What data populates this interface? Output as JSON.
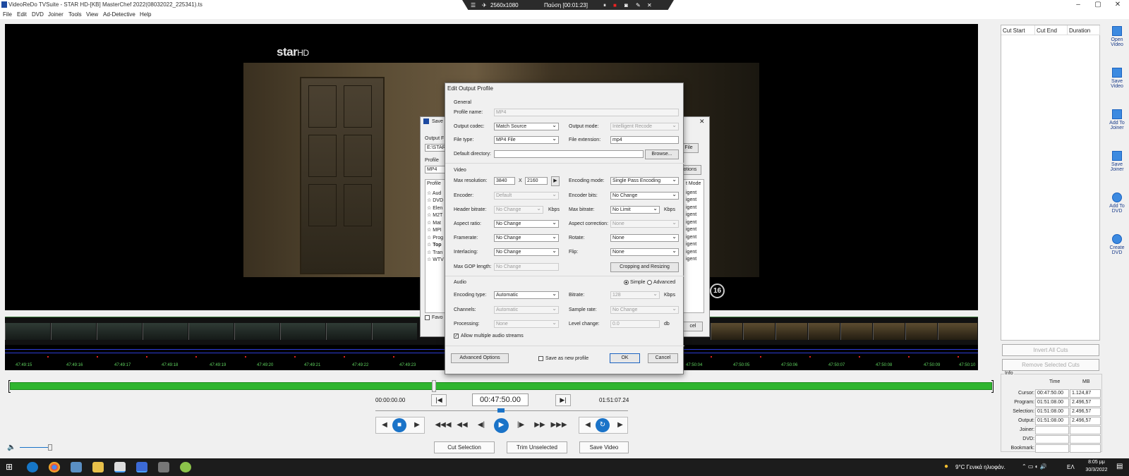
{
  "window": {
    "title": "VideoReDo TVSuite - STAR HD-[KB] MasterChef 2022(08032022_225341).ts"
  },
  "recorder": {
    "resolution": "2560x1080",
    "status": "Παύση [00:01:23]"
  },
  "menu": [
    "File",
    "Edit",
    "DVD",
    "Joiner",
    "Tools",
    "View",
    "Ad-Detective",
    "Help"
  ],
  "video": {
    "channel_logo": "star",
    "channel_logo_suffix": "HD",
    "age_rating": "16"
  },
  "ruler_ticks": [
    "47:49:15",
    "47:49:16",
    "47:49:17",
    "47:49:18",
    "47:49:19",
    "47:49:20",
    "47:49:21",
    "47:49:22",
    "47:49:23",
    "47:50:04",
    "47:50:05",
    "47:50:06",
    "47:50:07",
    "47:50:08",
    "47:50:09",
    "47:50:10"
  ],
  "timecodes": {
    "start": "00:00:00.00",
    "cursor": "00:47:50.00",
    "end": "01:51:07.24"
  },
  "bottom_buttons": {
    "cut": "Cut Selection",
    "trim": "Trim Unselected",
    "save": "Save Video"
  },
  "cutlist": {
    "headers": [
      "Cut Start",
      "Cut End",
      "Duration"
    ],
    "invert": "Invert All Cuts",
    "remove": "Remove Selected Cuts"
  },
  "side_buttons": [
    {
      "l1": "Open",
      "l2": "Video"
    },
    {
      "l1": "Save",
      "l2": "Video"
    },
    {
      "l1": "Add To",
      "l2": "Joiner"
    },
    {
      "l1": "Save",
      "l2": "Joiner"
    },
    {
      "l1": "Add To",
      "l2": "DVD"
    },
    {
      "l1": "Create",
      "l2": "DVD"
    }
  ],
  "info": {
    "title": "Info",
    "col_time": "Time",
    "col_mb": "MB",
    "rows": [
      {
        "label": "Cursor:",
        "time": "00:47:50.00",
        "mb": "1.124,87"
      },
      {
        "label": "Program:",
        "time": "01:51:08.00",
        "mb": "2.496,57"
      },
      {
        "label": "Selection:",
        "time": "01:51:08.00",
        "mb": "2.496,57"
      },
      {
        "label": "Output:",
        "time": "01:51:08.00",
        "mb": "2.496,57"
      },
      {
        "label": "Joiner:",
        "time": "",
        "mb": ""
      },
      {
        "label": "DVD:",
        "time": "",
        "mb": ""
      },
      {
        "label": "Bookmark:",
        "time": "",
        "mb": ""
      }
    ]
  },
  "save_dialog": {
    "title": "Save",
    "output_label": "Output F",
    "path": "E:\\STAR",
    "profile_label": "Profile",
    "profile": "MP4",
    "list_header": "Profile",
    "items": [
      "Aud",
      "DVD",
      "Elen",
      "M2T",
      "Mat",
      "MPI",
      "Prog",
      "Top",
      "Tran",
      "WTV"
    ],
    "right_header": "t Mode",
    "right_items": [
      "igent",
      "igent",
      "igent",
      "igent",
      "igent",
      "igent",
      "igent",
      "igent",
      "igent",
      "igent"
    ],
    "file_btn": "File",
    "options_btn": "otions",
    "cancel": "cel",
    "fav": "Favo"
  },
  "dialog": {
    "title": "Edit Output Profile",
    "general": "General",
    "profile_name_label": "Profile name:",
    "profile_name": "MP4",
    "codec_label": "Output codec:",
    "codec": "Match Source",
    "mode_label": "Output mode:",
    "mode": "Intelligent Recode",
    "filetype_label": "File type:",
    "filetype": "MP4 File",
    "ext_label": "File extension:",
    "ext": "mp4",
    "dir_label": "Default directory:",
    "dir": "",
    "browse": "Browse...",
    "video": "Video",
    "maxres_label": "Max resolution:",
    "res_w": "3840",
    "res_x": "X",
    "res_h": "2160",
    "encmode_label": "Encoding mode:",
    "encmode": "Single Pass Encoding",
    "encoder_label": "Encoder:",
    "encoder": "Default",
    "encbits_label": "Encoder bits:",
    "encbits": "No Change",
    "hdrbit_label": "Header bitrate:",
    "hdrbit": "No Change",
    "kbps": "Kbps",
    "maxbit_label": "Max bitrate:",
    "maxbit": "No Limit",
    "aspect_label": "Aspect ratio:",
    "aspect": "No Change",
    "aspcorr_label": "Aspect correction:",
    "aspcorr": "None",
    "fps_label": "Framerate:",
    "fps": "No Change",
    "rotate_label": "Rotate:",
    "rotate": "None",
    "inter_label": "Interlacing:",
    "inter": "No Change",
    "flip_label": "Flip:",
    "flip": "None",
    "gop_label": "Max GOP length:",
    "gop": "No Change",
    "crop": "Cropping and Resizing",
    "audio": "Audio",
    "simple": "Simple",
    "advanced": "Advanced",
    "aenc_label": "Encoding type:",
    "aenc": "Automatic",
    "abit_label": "Bitrate:",
    "abit": "128",
    "chan_label": "Channels:",
    "chan": "Automatic",
    "srate_label": "Sample rate:",
    "srate": "No Change",
    "proc_label": "Processing:",
    "proc": "None",
    "lvl_label": "Level change:",
    "lvl": "0.0",
    "db": "db",
    "multi": "Allow multiple audio streams",
    "adv_btn": "Advanced Options",
    "save_new": "Save as new profile",
    "ok": "OK",
    "cancel": "Cancel"
  },
  "taskbar": {
    "weather": "9°C  Γενικά ηλιοφάν.",
    "lang": "ΕΛ",
    "time": "8:05 μμ",
    "date": "30/3/2022"
  },
  "colors": {
    "accent": "#1a73c8",
    "timeline": "#2fb52f"
  }
}
